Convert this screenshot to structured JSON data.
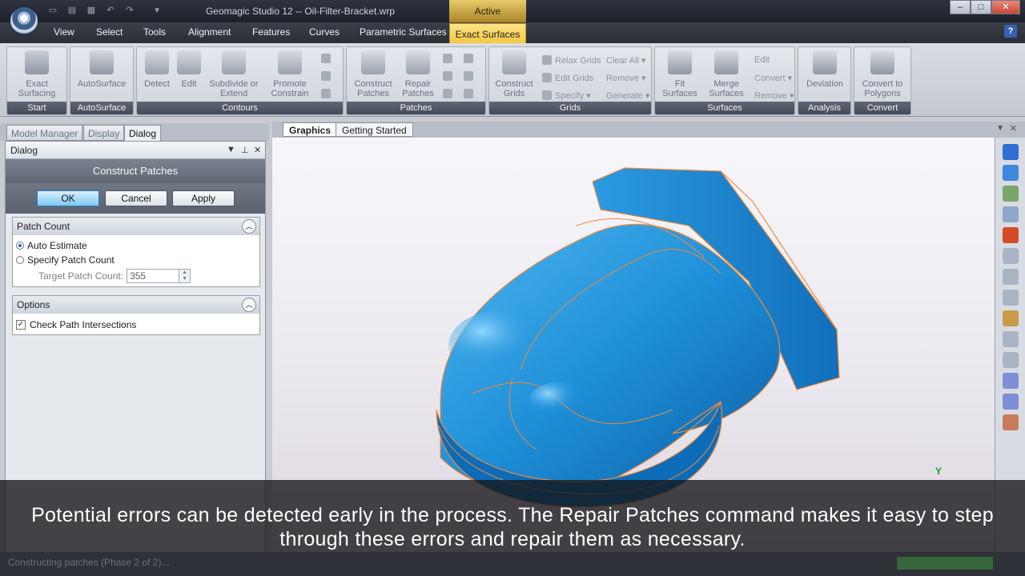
{
  "window": {
    "title": "Geomagic Studio 12 -- Oil-Filter-Bracket.wrp",
    "active_label": "Active"
  },
  "ribbon_tabs": [
    "View",
    "Select",
    "Tools",
    "Alignment",
    "Features",
    "Curves",
    "Parametric Surfaces",
    "Exact Surfaces"
  ],
  "help_label": "?",
  "ribbon": {
    "start": {
      "button": "Exact\nSurfacing",
      "label": "Start"
    },
    "autosurface": {
      "button": "AutoSurface",
      "label": "AutoSurface"
    },
    "contours": {
      "detect": "Detect",
      "edit": "Edit",
      "subdivide": "Subdivide or\nExtend",
      "promote": "Promote\nConstrain",
      "label": "Contours"
    },
    "patches": {
      "construct": "Construct\nPatches",
      "repair": "Repair\nPatches",
      "label": "Patches"
    },
    "grids": {
      "construct": "Construct\nGrids",
      "relax": "Relax Grids",
      "edit": "Edit Grids",
      "specify": "Specify",
      "clear_all": "Clear All",
      "remove": "Remove",
      "generate": "Generate",
      "label": "Grids"
    },
    "surfaces": {
      "fit": "Fit\nSurfaces",
      "merge": "Merge\nSurfaces",
      "edit": "Edit",
      "convert": "Convert",
      "remove": "Remove",
      "label": "Surfaces"
    },
    "analysis": {
      "deviation": "Deviation",
      "label": "Analysis"
    },
    "convert": {
      "polygons": "Convert to\nPolygons",
      "label": "Convert"
    }
  },
  "panel_tabs": [
    "Model Manager",
    "Display",
    "Dialog"
  ],
  "panel": {
    "header": "Dialog",
    "dialog_title": "Construct Patches",
    "buttons": {
      "ok": "OK",
      "cancel": "Cancel",
      "apply": "Apply"
    },
    "patch_count": {
      "title": "Patch Count",
      "auto_estimate": "Auto Estimate",
      "specify": "Specify Patch Count",
      "target_label": "Target Patch Count:",
      "target_value": "355"
    },
    "options": {
      "title": "Options",
      "check_path": "Check Path Intersections"
    }
  },
  "viewport_tabs": [
    "Graphics",
    "Getting Started"
  ],
  "axis_label": "Y",
  "caption": "Potential errors can be detected early in the process. The Repair Patches command makes it easy to step through these errors and repair them as necessary.",
  "status": "Constructing patches (Phase 2 of 2)...",
  "colors": {
    "model": "#1e8fd8",
    "patch_edges": "#f08a3a",
    "accent_tab": "#f5c640"
  }
}
